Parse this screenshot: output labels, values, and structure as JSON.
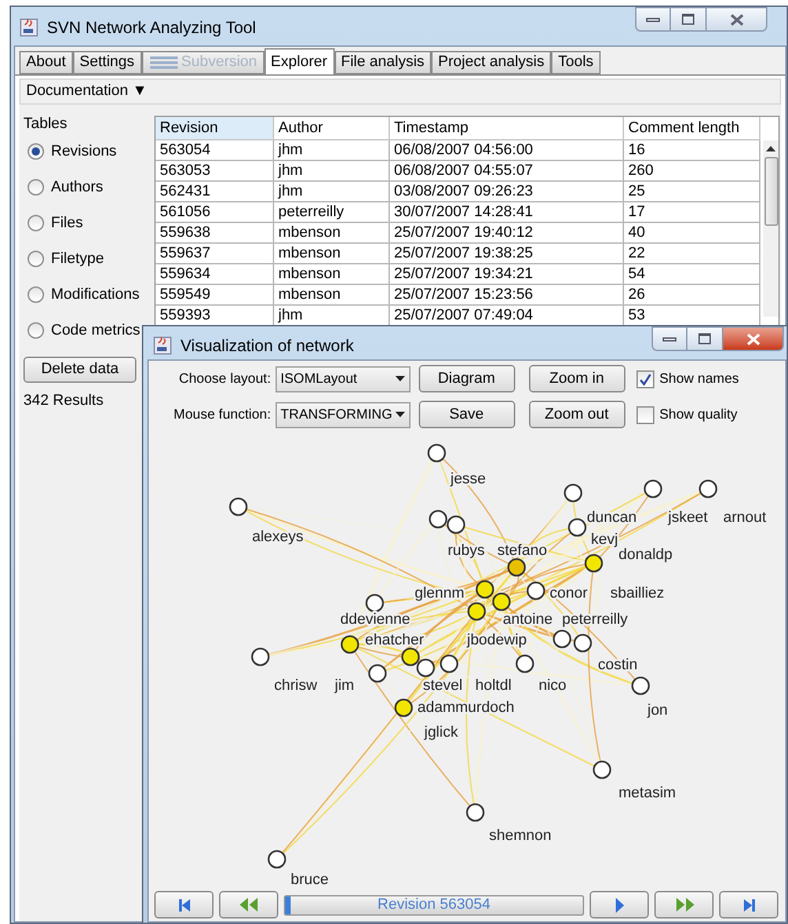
{
  "window": {
    "title": "SVN Network Analyzing Tool"
  },
  "tabs": [
    {
      "label": "About",
      "selected": false,
      "disabled": false
    },
    {
      "label": "Settings",
      "selected": false,
      "disabled": false
    },
    {
      "label": "Subversion",
      "selected": false,
      "disabled": true
    },
    {
      "label": "Explorer",
      "selected": true,
      "disabled": false
    },
    {
      "label": "File analysis",
      "selected": false,
      "disabled": false
    },
    {
      "label": "Project analysis",
      "selected": false,
      "disabled": false
    },
    {
      "label": "Tools",
      "selected": false,
      "disabled": false
    }
  ],
  "menu": {
    "label": "Documentation ▼"
  },
  "tables_panel": {
    "title": "Tables",
    "options": [
      {
        "label": "Revisions",
        "selected": true
      },
      {
        "label": "Authors",
        "selected": false
      },
      {
        "label": "Files",
        "selected": false
      },
      {
        "label": "Filetype",
        "selected": false
      },
      {
        "label": "Modifications",
        "selected": false
      },
      {
        "label": "Code metrics",
        "selected": false
      }
    ],
    "delete_button": "Delete data",
    "results": "342 Results"
  },
  "table": {
    "columns": [
      "Revision",
      "Author",
      "Timestamp",
      "Comment length"
    ],
    "rows": [
      [
        "563054",
        "jhm",
        "06/08/2007 04:56:00",
        "16"
      ],
      [
        "563053",
        "jhm",
        "06/08/2007 04:55:07",
        "260"
      ],
      [
        "562431",
        "jhm",
        "03/08/2007 09:26:23",
        "25"
      ],
      [
        "561056",
        "peterreilly",
        "30/07/2007 14:28:41",
        "17"
      ],
      [
        "559638",
        "mbenson",
        "25/07/2007 19:40:12",
        "40"
      ],
      [
        "559637",
        "mbenson",
        "25/07/2007 19:38:25",
        "22"
      ],
      [
        "559634",
        "mbenson",
        "25/07/2007 19:34:21",
        "54"
      ],
      [
        "559549",
        "mbenson",
        "25/07/2007 15:23:56",
        "26"
      ],
      [
        "559393",
        "jhm",
        "25/07/2007 07:49:04",
        "53"
      ]
    ]
  },
  "network_window": {
    "title": "Visualization of network",
    "layout_label": "Choose layout:",
    "layout_value": "ISOMLayout",
    "mouse_label": "Mouse function:",
    "mouse_value": "TRANSFORMING",
    "buttons": [
      "Diagram",
      "Zoom in",
      "Save",
      "Zoom out"
    ],
    "checkboxes": [
      {
        "label": "Show names",
        "checked": true
      },
      {
        "label": "Show quality",
        "checked": false
      }
    ],
    "nodes": [
      {
        "name": "jesse",
        "color": "#ffffff"
      },
      {
        "name": "duncan",
        "color": "#ffffff"
      },
      {
        "name": "jskeet",
        "color": "#ffffff"
      },
      {
        "name": "arnout",
        "color": "#ffffff"
      },
      {
        "name": "alexeys",
        "color": "#ffffff"
      },
      {
        "name": "kevj",
        "color": "#ffffff"
      },
      {
        "name": "rubys",
        "color": "#ffffff"
      },
      {
        "name": "stefano",
        "color": "#ffffff"
      },
      {
        "name": "donaldp",
        "color": "#f2e600"
      },
      {
        "name": "glennm",
        "color": "#f2e600"
      },
      {
        "name": "conor",
        "color": "#ffffff"
      },
      {
        "name": "sbailliez",
        "color": "#e8c000"
      },
      {
        "name": "ddevienne",
        "color": "#ffffff"
      },
      {
        "name": "antoine",
        "color": "#f2e600"
      },
      {
        "name": "peterreilly",
        "color": "#f2e600"
      },
      {
        "name": "ehatcher",
        "color": "#f2e600"
      },
      {
        "name": "jbodewip",
        "color": "#ffffff"
      },
      {
        "name": "costin",
        "color": "#ffffff"
      },
      {
        "name": "chrisw",
        "color": "#ffffff"
      },
      {
        "name": "jim",
        "color": "#ffffff"
      },
      {
        "name": "stevel",
        "color": "#ffffff"
      },
      {
        "name": "holtdl",
        "color": "#ffffff"
      },
      {
        "name": "nico",
        "color": "#ffffff"
      },
      {
        "name": "adammurdoch",
        "color": "#f2e600"
      },
      {
        "name": "jon",
        "color": "#ffffff"
      },
      {
        "name": "jglick",
        "color": "#f2e600"
      },
      {
        "name": "metasim",
        "color": "#ffffff"
      },
      {
        "name": "shemnon",
        "color": "#ffffff"
      },
      {
        "name": "bruce",
        "color": "#ffffff"
      }
    ],
    "revision": {
      "label": "Revision 563054",
      "level": 0.02
    }
  }
}
